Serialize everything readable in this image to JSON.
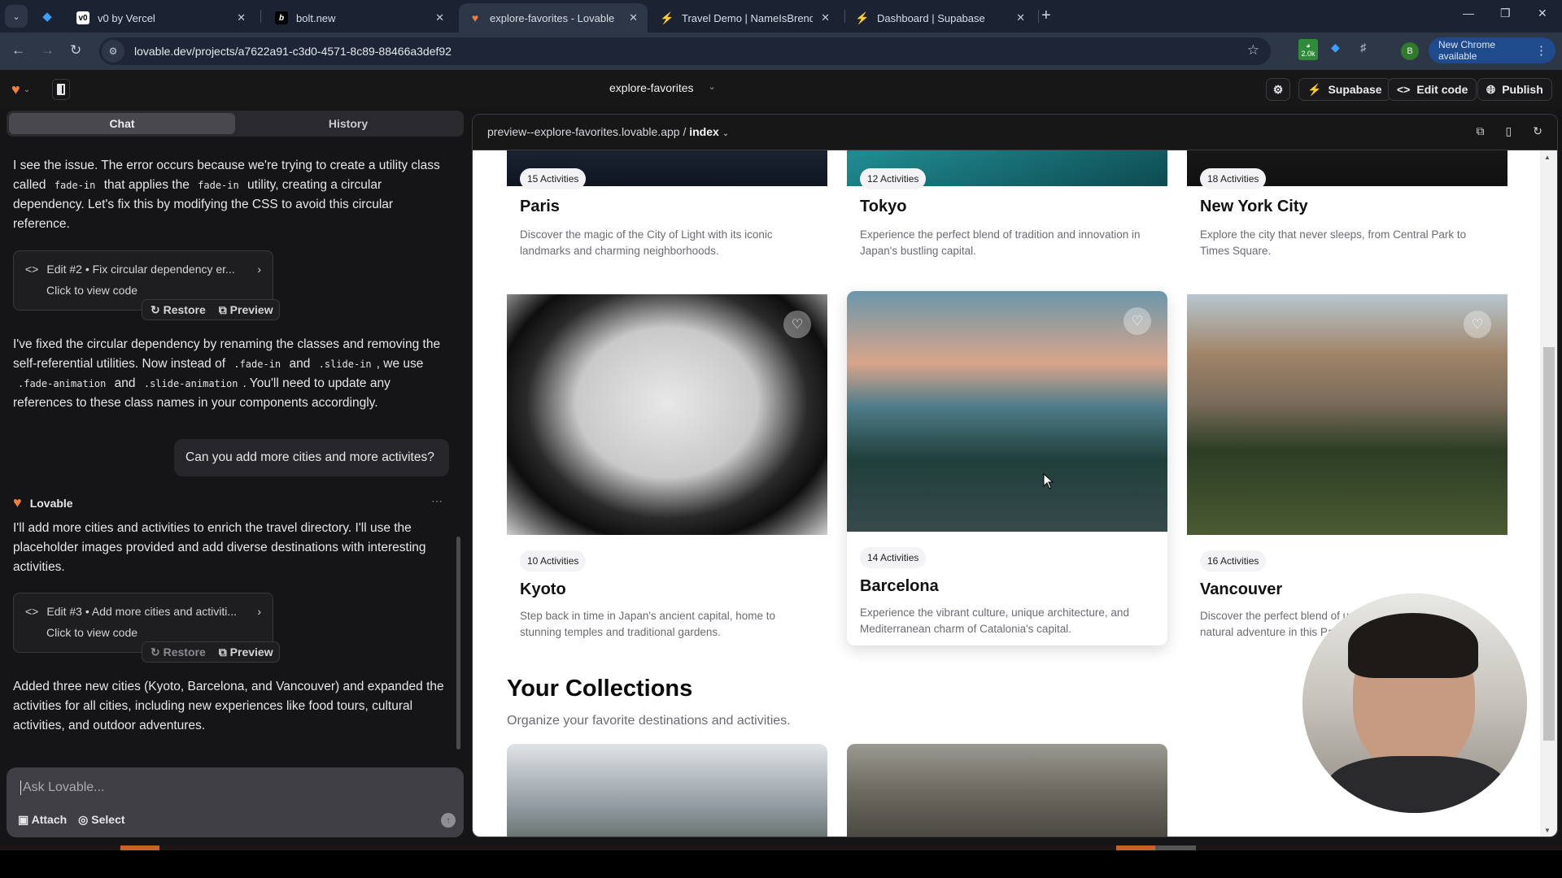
{
  "browser": {
    "tabs": [
      {
        "title": "v0 by Vercel",
        "icon": "v0-icon"
      },
      {
        "title": "bolt.new",
        "icon": "bolt-icon"
      },
      {
        "title": "explore-favorites - Lovable",
        "icon": "lovable-heart-icon",
        "active": true
      },
      {
        "title": "Travel Demo | NameIsBrendan |",
        "icon": "supabase-bolt-icon"
      },
      {
        "title": "Dashboard | Supabase",
        "icon": "supabase-bolt-icon"
      }
    ],
    "url": "lovable.dev/projects/a7622a91-c3d0-4571-8c89-88466a3def92",
    "extension_badge": "2.0k",
    "profile_initial": "B",
    "update_label": "New Chrome available"
  },
  "header": {
    "project_name": "explore-favorites",
    "buttons": {
      "supabase": "Supabase",
      "edit_code": "Edit code",
      "publish": "Publish"
    }
  },
  "chat": {
    "tabs": [
      "Chat",
      "History"
    ],
    "active_tab": "Chat",
    "messages": {
      "m1": {
        "p1": "I see the issue. The error occurs because we're trying to create a utility class called ",
        "c1": "fade-in",
        "p2": " that applies the ",
        "c2": "fade-in",
        "p3": " utility, creating a circular dependency. Let's fix this by modifying the CSS to avoid this circular reference."
      },
      "edit2": {
        "title": "Edit #2 • Fix circular dependency er...",
        "sub": "Click to view code",
        "restore": "Restore",
        "preview": "Preview"
      },
      "m2": {
        "p1": "I've fixed the circular dependency by renaming the classes and removing the self-referential utilities. Now instead of ",
        "c1": ".fade-in",
        "p2": " and ",
        "c2": ".slide-in",
        "p3": ", we use ",
        "c3": ".fade-animation",
        "p4": " and ",
        "c4": ".slide-animation",
        "p5": ". You'll need to update any references to these class names in your components accordingly."
      },
      "user": "Can you add more cities and more activites?",
      "bot_name": "Lovable",
      "m3": "I'll add more cities and activities to enrich the travel directory. I'll use the placeholder images provided and add diverse destinations with interesting activities.",
      "edit3": {
        "title": "Edit #3 • Add more cities and activiti...",
        "sub": "Click to view code",
        "restore": "Restore",
        "preview": "Preview"
      },
      "m4": "Added three new cities (Kyoto, Barcelona, and Vancouver) and expanded the activities for all cities, including new experiences like food tours, cultural activities, and outdoor adventures."
    },
    "composer": {
      "placeholder": "Ask Lovable...",
      "attach": "Attach",
      "select": "Select"
    }
  },
  "preview": {
    "url_host": "preview--explore-favorites.lovable.app",
    "url_sep": " / ",
    "url_page": "index",
    "cities": [
      {
        "badge": "15 Activities",
        "name": "Paris",
        "desc": "Discover the magic of the City of Light with its iconic landmarks and charming neighborhoods."
      },
      {
        "badge": "12 Activities",
        "name": "Tokyo",
        "desc": "Experience the perfect blend of tradition and innovation in Japan's bustling capital."
      },
      {
        "badge": "18 Activities",
        "name": "New York City",
        "desc": "Explore the city that never sleeps, from Central Park to Times Square."
      },
      {
        "badge": "10 Activities",
        "name": "Kyoto",
        "desc": "Step back in time in Japan's ancient capital, home to stunning temples and traditional gardens."
      },
      {
        "badge": "14 Activities",
        "name": "Barcelona",
        "desc": "Experience the vibrant culture, unique architecture, and Mediterranean charm of Catalonia's capital."
      },
      {
        "badge": "16 Activities",
        "name": "Vancouver",
        "desc": "Discover the perfect blend of urban sophistication and natural adventure in this Pacific Northwest gem."
      }
    ],
    "collections_title": "Your Collections",
    "collections_sub": "Organize your favorite destinations and activities."
  },
  "colors": {
    "accent_orange": "#c0652a",
    "chrome_blue": "#1f4a8c"
  }
}
